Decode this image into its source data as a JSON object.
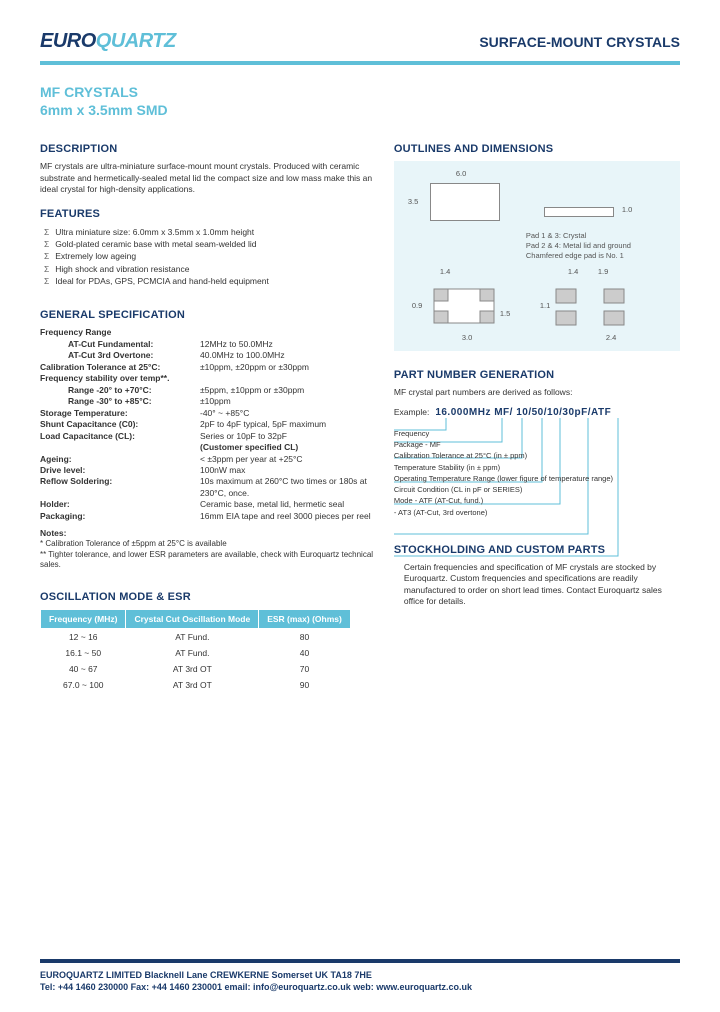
{
  "header": {
    "logo_euro": "EURO",
    "logo_quartz": "QUARTZ",
    "doc_title": "SURFACE-MOUNT CRYSTALS"
  },
  "product": {
    "line1": "MF CRYSTALS",
    "line2": "6mm x 3.5mm SMD"
  },
  "description": {
    "heading": "DESCRIPTION",
    "text": "MF crystals are ultra-miniature surface-mount mount crystals. Produced with ceramic substrate and hermetically-sealed metal lid the compact size and low mass make this an ideal crystal for high-density applications."
  },
  "features": {
    "heading": "FEATURES",
    "items": [
      "Ultra miniature size: 6.0mm x 3.5mm x 1.0mm height",
      "Gold-plated ceramic base with metal seam-welded lid",
      "Extremely low ageing",
      "High shock and vibration resistance",
      "Ideal for PDAs, GPS, PCMCIA and hand-held equipment"
    ]
  },
  "genspec": {
    "heading": "GENERAL SPECIFICATION",
    "freq_range_label": "Frequency Range",
    "freq_fund_label": "AT-Cut Fundamental:",
    "freq_fund_val": "12MHz to 50.0MHz",
    "freq_ot_label": "AT-Cut 3rd Overtone:",
    "freq_ot_val": "40.0MHz to 100.0MHz",
    "cal_tol_label": "Calibration Tolerance at 25°C:",
    "cal_tol_val": "±10ppm, ±20ppm or ±30ppm",
    "stab_label": "Frequency stability over temp**.",
    "stab_r1_label": "Range -20° to +70°C:",
    "stab_r1_val": "±5ppm, ±10ppm or ±30ppm",
    "stab_r2_label": "Range -30° to +85°C:",
    "stab_r2_val": "±10ppm",
    "storage_label": "Storage Temperature:",
    "storage_val": "-40° ~ +85°C",
    "shunt_label": "Shunt Capacitance (C0):",
    "shunt_val": "2pF to 4pF typical, 5pF maximum",
    "load_label": "Load Capacitance (CL):",
    "load_val1": "Series or 10pF to 32pF",
    "load_val2": "(Customer specified CL)",
    "ageing_label": "Ageing:",
    "ageing_val": "< ±3ppm per year at +25°C",
    "drive_label": "Drive level:",
    "drive_val": "100nW max",
    "reflow_label": "Reflow Soldering:",
    "reflow_val": "10s maximum at 260°C two times or 180s at 230°C, once.",
    "holder_label": "Holder:",
    "holder_val": "Ceramic base, metal lid, hermetic seal",
    "pack_label": "Packaging:",
    "pack_val": "16mm EIA tape and reel 3000 pieces per reel",
    "notes_heading": "Notes:",
    "note1": "*   Calibration Tolerance of ±5ppm at 25°C is available",
    "note2": "** Tighter tolerance, and lower ESR parameters are available, check with Euroquartz technical sales."
  },
  "osc": {
    "heading": "OSCILLATION MODE & ESR",
    "th_freq": "Frequency (MHz)",
    "th_mode": "Crystal Cut Oscillation Mode",
    "th_esr": "ESR (max) (Ohms)",
    "rows": [
      {
        "f": "12 ~ 16",
        "m": "AT Fund.",
        "e": "80"
      },
      {
        "f": "16.1 ~ 50",
        "m": "AT Fund.",
        "e": "40"
      },
      {
        "f": "40 ~ 67",
        "m": "AT 3rd OT",
        "e": "70"
      },
      {
        "f": "67.0 ~ 100",
        "m": "AT 3rd OT",
        "e": "90"
      }
    ]
  },
  "outlines": {
    "heading": "OUTLINES AND DIMENSIONS",
    "w": "6.0",
    "h": "3.5",
    "t": "1.0",
    "pad_note1": "Pad 1 & 3: Crystal",
    "pad_note2": "Pad 2 & 4: Metal lid and ground",
    "pad_note3": "Chamfered edge pad is No. 1",
    "d14": "1.4",
    "d09": "0.9",
    "d15": "1.5",
    "d30": "3.0",
    "d19": "1.9",
    "d11": "1.1",
    "d24": "2.4"
  },
  "pn": {
    "heading": "PART NUMBER GENERATION",
    "intro": "MF crystal part numbers are derived as follows:",
    "ex_label": "Example:",
    "ex_val": "16.000MHz    MF/ 10/50/10/30pF/ATF",
    "legend": {
      "freq": "Frequency",
      "pkg": "Package - MF",
      "cal": "Calibration Tolerance at 25°C (in ± ppm)",
      "stab": "Temperature Stability (in ± ppm)",
      "range": "Operating Temperature Range (lower figure of temperature range)",
      "circuit": "Circuit Condition (CL in pF or SERIES)",
      "mode": "Mode    - ATF (AT-Cut, fund.)",
      "mode2": "            - AT3 (AT-Cut, 3rd overtone)"
    }
  },
  "stock": {
    "heading": "STOCKHOLDING AND CUSTOM PARTS",
    "text": "Certain frequencies and specification of MF crystals are stocked by Euroquartz. Custom frequencies and specifications are readily manufactured to order on short lead times. Contact Euroquartz sales office for details."
  },
  "footer": {
    "line1": "EUROQUARTZ LIMITED   Blacknell Lane  CREWKERNE  Somerset UK   TA18 7HE",
    "line2": "Tel: +44 1460 230000     Fax: +44 1460 230001     email: info@euroquartz.co.uk    web: www.euroquartz.co.uk"
  }
}
